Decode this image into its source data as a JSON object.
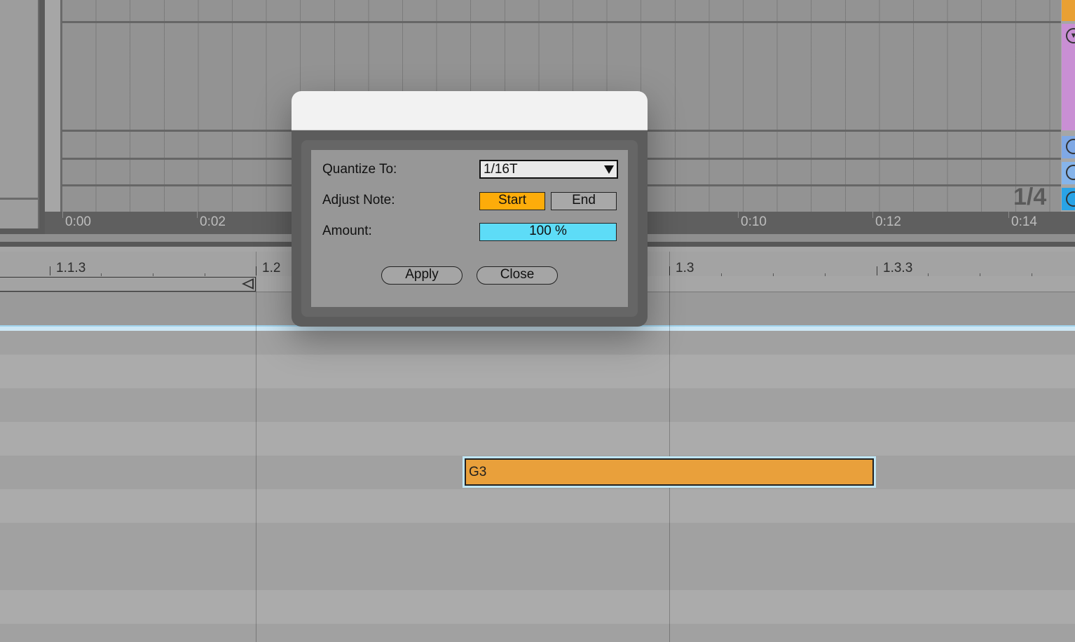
{
  "arrangement": {
    "time_ruler": [
      "0:00",
      "0:02",
      "0:10",
      "0:12",
      "0:14"
    ],
    "page_counter": "1/4"
  },
  "clip_editor": {
    "beat_ruler": [
      "1.1.3",
      "1.2",
      "1.3",
      "1.3.3"
    ],
    "note": {
      "name": "G3",
      "color": "#e9a03b"
    }
  },
  "dialog": {
    "quantize_label": "Quantize To:",
    "quantize_value": "1/16T",
    "adjust_label": "Adjust Note:",
    "adjust_start": "Start",
    "adjust_end": "End",
    "amount_label": "Amount:",
    "amount_value": "100 %",
    "apply_label": "Apply",
    "close_label": "Close",
    "colors": {
      "start_active": "#fdac0a",
      "amount_fill": "#5ddcf7"
    }
  }
}
